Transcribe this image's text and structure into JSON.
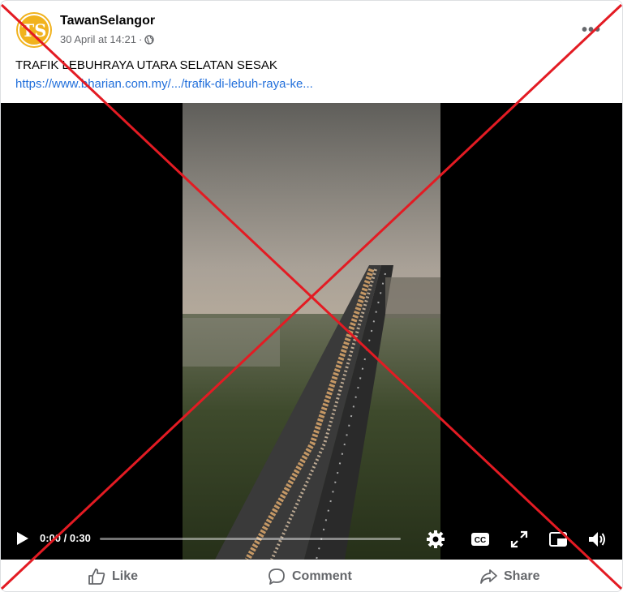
{
  "post": {
    "avatar_initials": "TS",
    "page_name": "TawanSelangor",
    "timestamp": "30 April at 14:21",
    "separator": "·",
    "text": "TRAFIK LEBUHRAYA UTARA SELATAN SESAK",
    "link": "https://www.bharian.com.my/.../trafik-di-lebuh-raya-ke...",
    "more_label": "•••"
  },
  "video": {
    "time": "0:00 / 0:30",
    "progress_fraction": 0.0
  },
  "actions": {
    "like": "Like",
    "comment": "Comment",
    "share": "Share"
  },
  "colors": {
    "avatar": "#f1b21d",
    "link": "#216fdb",
    "cross": "#e31b23",
    "muted": "#65676b"
  },
  "icons": [
    "globe-icon",
    "more-options-icon",
    "play-icon",
    "settings-icon",
    "cc-icon",
    "fullscreen-icon",
    "pip-icon",
    "volume-icon",
    "like-icon",
    "comment-icon",
    "share-icon"
  ]
}
